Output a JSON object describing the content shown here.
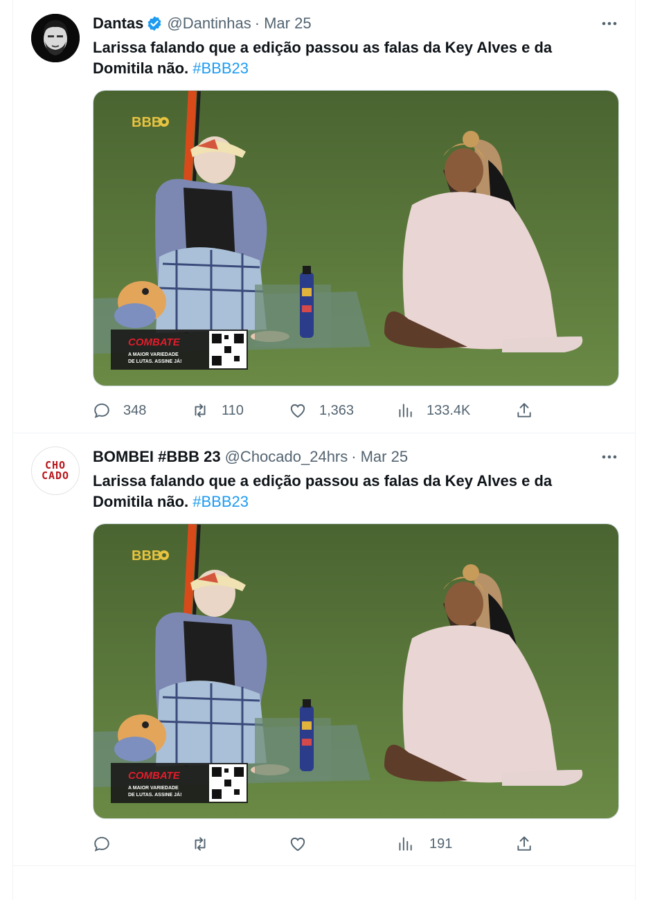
{
  "tweets": [
    {
      "author_name": "Dantas",
      "handle": "@Dantinhas",
      "separator": "·",
      "date": "Mar 25",
      "text": "Larissa falando que a edição passou as falas da Key Alves e da Domitila não.",
      "hashtag": "#BBB23",
      "avatar_icon": "avatar-photo-bearded-man",
      "verified": true,
      "media": {
        "logo": "BBB",
        "ad_title": "COMBATE",
        "ad_line1": "A MAIOR VARIEDADE",
        "ad_line2": "DE LUTAS. ASSINE JÁ!"
      },
      "stats": {
        "replies": "348",
        "retweets": "110",
        "likes": "1,363",
        "views": "133.4K"
      }
    },
    {
      "author_name": "BOMBEI #BBB 23",
      "handle": "@Chocado_24hrs",
      "separator": "·",
      "date": "Mar 25",
      "text": "Larissa falando que a edição passou as falas da Key Alves e da Domitila não.",
      "hashtag": "#BBB23",
      "avatar_logo_line1": "CHO",
      "avatar_logo_line2": "CADO",
      "verified": false,
      "media": {
        "logo": "BBB",
        "ad_title": "COMBATE",
        "ad_line1": "A MAIOR VARIEDADE",
        "ad_line2": "DE LUTAS. ASSINE JÁ!"
      },
      "stats": {
        "replies": "",
        "retweets": "",
        "likes": "",
        "views": "191"
      }
    }
  ],
  "colors": {
    "accent": "#1d9bf0",
    "secondary_text": "#536471",
    "grass": "#5d7a3e",
    "combate_red": "#e31d2b"
  },
  "icons": [
    "reply-icon",
    "retweet-icon",
    "like-icon",
    "views-icon",
    "share-icon",
    "more-icon",
    "verified-icon"
  ]
}
